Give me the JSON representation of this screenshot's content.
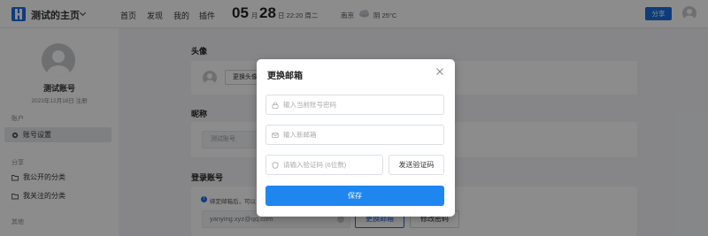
{
  "header": {
    "site_title": "测试的主页",
    "nav": [
      "首页",
      "发现",
      "我的",
      "插件"
    ],
    "date_month": "05",
    "date_month_unit": "月",
    "date_day": "28",
    "date_rest": "日 22:20 周二",
    "city": "南京",
    "weather": "阴 25°C",
    "share_label": "分享",
    "accent_color": "#1a6ee0"
  },
  "sidebar": {
    "username": "测试账号",
    "register_date": "2023年12月18日 注册",
    "section_account": "账户",
    "item_account_settings": "账号设置",
    "section_share": "分享",
    "item_my_public": "我公开的分类",
    "item_my_followed": "我关注的分类",
    "section_other": "其他"
  },
  "main": {
    "avatar_title": "头像",
    "change_avatar_label": "更换头像",
    "nickname_title": "昵称",
    "nickname_value": "测试账号",
    "login_title": "登录账号",
    "bind_tip": "绑定邮箱后，可以",
    "email_value": "yanying.xyz@qq.com",
    "change_email_label": "更换邮箱",
    "change_password_label": "修改密码"
  },
  "modal": {
    "title": "更换邮箱",
    "password_placeholder": "输入当前账号密码",
    "new_email_placeholder": "输入新邮箱",
    "code_placeholder": "请输入验证码 (6位数)",
    "send_code_label": "发送验证码",
    "save_label": "保存",
    "primary_color": "#1f86f0"
  }
}
